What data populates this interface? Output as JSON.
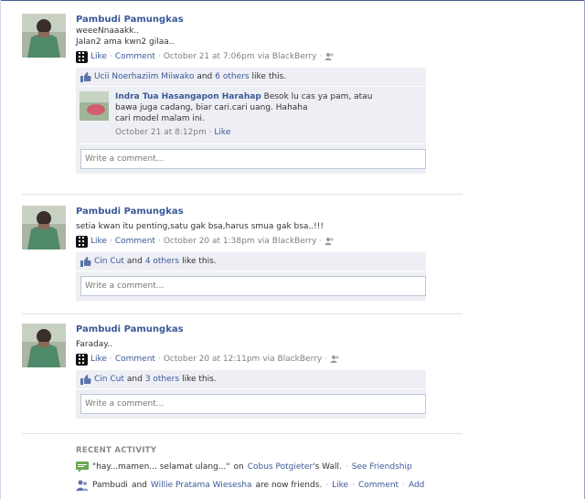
{
  "posts": [
    {
      "author": "Pambudi Pamungkas",
      "message_lines": [
        "weeeNnaaakk..",
        "Jalan2 ama kwn2 gilaa.."
      ],
      "like": "Like",
      "comment": "Comment",
      "time": "October 21 at 7:06pm",
      "via": "via BlackBerry",
      "likes_name": "Ucii Noerhaziim Miiwako",
      "likes_and": "and",
      "likes_others": "6 others",
      "likes_suffix": "like this.",
      "comment_item": {
        "name": "Indra Tua Hasangapon Harahap",
        "text_lines": [
          "Besok lu cas ya pam, atau",
          "bawa juga cadang, biar cari.cari uang. Hahaha",
          "cari model malam ini."
        ],
        "time": "October 21 at 8:12pm",
        "like": "Like"
      },
      "write_placeholder": "Write a comment..."
    },
    {
      "author": "Pambudi Pamungkas",
      "message_lines": [
        "setia kwan itu penting,satu gak bsa,harus smua gak bsa..!!!"
      ],
      "like": "Like",
      "comment": "Comment",
      "time": "October 20 at 1:38pm",
      "via": "via BlackBerry",
      "likes_name": "Cin Cut",
      "likes_and": "and",
      "likes_others": "4 others",
      "likes_suffix": "like this.",
      "write_placeholder": "Write a comment..."
    },
    {
      "author": "Pambudi Pamungkas",
      "message_lines": [
        "Faraday.."
      ],
      "like": "Like",
      "comment": "Comment",
      "time": "October 20 at 12:11pm",
      "via": "via BlackBerry",
      "likes_name": "Cin Cut",
      "likes_and": "and",
      "likes_others": "3 others",
      "likes_suffix": "like this.",
      "write_placeholder": "Write a comment..."
    }
  ],
  "recent": {
    "title": "RECENT ACTIVITY",
    "wall_post": {
      "quote": "\"hay...mamen... selamat ulang...\"",
      "on": "on",
      "wall_owner": "Cobus Potgieter",
      "wall_suffix": "'s Wall.",
      "see_friendship": "See Friendship"
    },
    "friends": {
      "person_a": "Pambudi",
      "and": "and",
      "person_b": "Willie Pratama Wiesesha",
      "suffix": "are now friends.",
      "like": "Like",
      "comment": "Comment",
      "add": "Add"
    }
  },
  "colors": {
    "link": "#3b5998",
    "box": "#edeff4",
    "muted": "#808080"
  }
}
